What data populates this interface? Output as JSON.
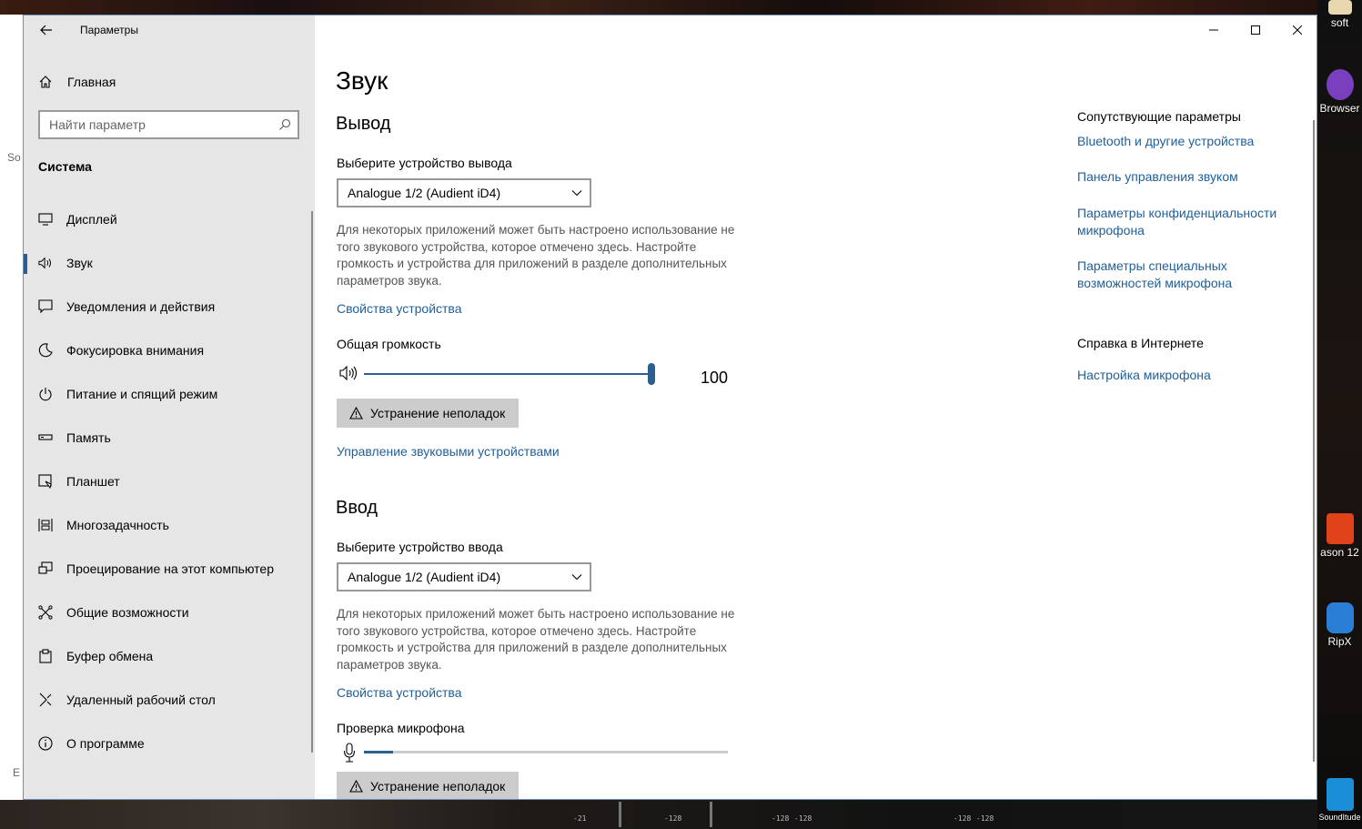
{
  "desktop": {
    "left_fragments": [
      "So",
      "E"
    ],
    "icons": [
      {
        "label": "soft",
        "color": "#e8d8b0"
      },
      {
        "label": "Browser",
        "color": "#7a3fbf"
      },
      {
        "label": "ason 12",
        "color": "#e0431a"
      },
      {
        "label": "RipX",
        "color": "#2a7fd4"
      },
      {
        "label": "SoundItude",
        "color": "#1a8fd8"
      }
    ],
    "mixer_labels": [
      "-21",
      "-128",
      "-128",
      "-128",
      "-128",
      "-128"
    ]
  },
  "window": {
    "title": "Параметры",
    "sidebar": {
      "home": "Главная",
      "search_placeholder": "Найти параметр",
      "section": "Система",
      "items": [
        {
          "label": "Дисплей",
          "icon": "display-icon"
        },
        {
          "label": "Звук",
          "icon": "speaker-icon",
          "active": true
        },
        {
          "label": "Уведомления и действия",
          "icon": "notification-icon"
        },
        {
          "label": "Фокусировка внимания",
          "icon": "moon-icon"
        },
        {
          "label": "Питание и спящий режим",
          "icon": "power-icon"
        },
        {
          "label": "Память",
          "icon": "storage-icon"
        },
        {
          "label": "Планшет",
          "icon": "tablet-icon"
        },
        {
          "label": "Многозадачность",
          "icon": "multitask-icon"
        },
        {
          "label": "Проецирование на этот компьютер",
          "icon": "project-icon"
        },
        {
          "label": "Общие возможности",
          "icon": "shared-icon"
        },
        {
          "label": "Буфер обмена",
          "icon": "clipboard-icon"
        },
        {
          "label": "Удаленный рабочий стол",
          "icon": "remote-desktop-icon"
        },
        {
          "label": "О программе",
          "icon": "info-icon"
        }
      ]
    },
    "main": {
      "title": "Звук",
      "output": {
        "heading": "Вывод",
        "device_label": "Выберите устройство вывода",
        "device_value": "Analogue 1/2 (Audient iD4)",
        "description": "Для некоторых приложений может быть настроено использование не того звукового устройства, которое отмечено здесь. Настройте громкость и устройства для приложений в разделе дополнительных параметров звука.",
        "properties_link": "Свойства устройства",
        "volume_label": "Общая громкость",
        "volume_value": "100",
        "volume_percent": 100,
        "troubleshoot": "Устранение неполадок",
        "manage_link": "Управление звуковыми устройствами"
      },
      "input": {
        "heading": "Ввод",
        "device_label": "Выберите устройство ввода",
        "device_value": "Analogue 1/2 (Audient iD4)",
        "description": "Для некоторых приложений может быть настроено использование не того звукового устройства, которое отмечено здесь. Настройте громкость и устройства для приложений в разделе дополнительных параметров звука.",
        "properties_link": "Свойства устройства",
        "mic_test_label": "Проверка микрофона",
        "mic_level_percent": 8,
        "troubleshoot": "Устранение неполадок"
      },
      "related": {
        "heading": "Сопутствующие параметры",
        "links": [
          "Bluetooth и другие устройства",
          "Панель управления звуком",
          "Параметры конфиденциальности микрофона",
          "Параметры специальных возможностей микрофона"
        ]
      },
      "help": {
        "heading": "Справка в Интернете",
        "links": [
          "Настройка микрофона"
        ]
      }
    },
    "accent_color": "#2b5f8f",
    "link_color": "#1f5f9a"
  }
}
